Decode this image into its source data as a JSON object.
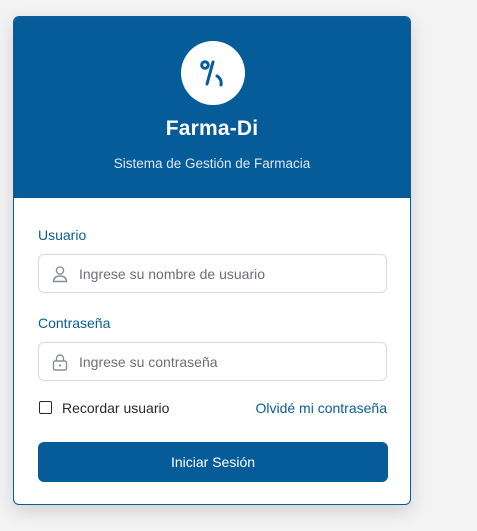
{
  "app": {
    "name": "Farma-Di",
    "subtitle": "Sistema de Gestión de Farmacia",
    "logo_icon": "percent-icon"
  },
  "form": {
    "username": {
      "label": "Usuario",
      "placeholder": "Ingrese su nombre de usuario",
      "value": "",
      "icon": "user-icon"
    },
    "password": {
      "label": "Contraseña",
      "placeholder": "Ingrese su contraseña",
      "value": "",
      "icon": "lock-icon"
    },
    "remember": {
      "label": "Recordar usuario",
      "checked": false
    },
    "forgot_link": "Olvidé mi contraseña",
    "submit_label": "Iniciar Sesión"
  },
  "colors": {
    "brand": "#065c99",
    "accent_text": "#0c5d96",
    "background": "#f3f3f4"
  }
}
